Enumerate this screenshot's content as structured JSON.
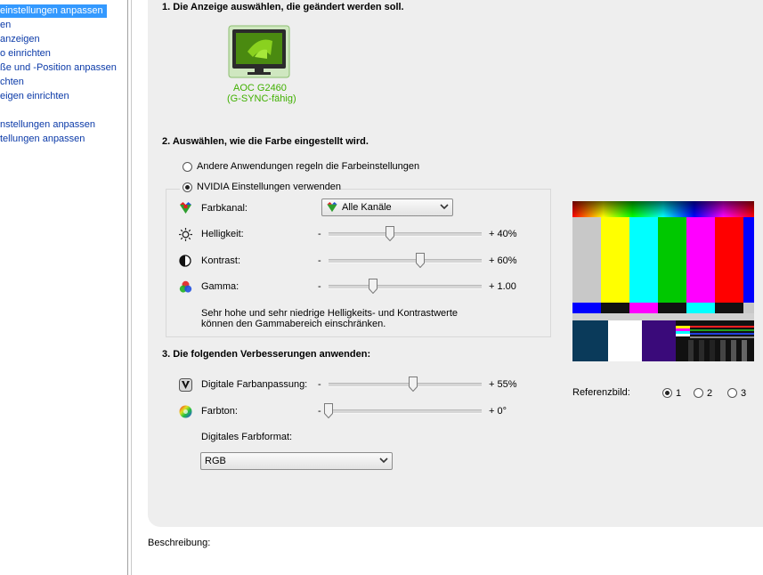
{
  "sidebar": {
    "items": [
      {
        "label": "einstellungen anpassen",
        "selected": true
      },
      {
        "label": "en"
      },
      {
        "label": "anzeigen"
      },
      {
        "label": "o einrichten"
      },
      {
        "label": "ße und -Position anpassen"
      },
      {
        "label": "chten"
      },
      {
        "label": "eigen einrichten"
      },
      {
        "label": "nstellungen anpassen"
      },
      {
        "label": "tellungen anpassen"
      }
    ]
  },
  "section1": {
    "heading": "1. Die Anzeige auswählen, die geändert werden soll.",
    "monitor": {
      "name": "AOC G2460",
      "sub": "(G-SYNC-fähig)",
      "icon": "nvidia-monitor-icon"
    }
  },
  "section2": {
    "heading": "2. Auswählen, wie die Farbe eingestellt wird.",
    "radio_other": "Andere Anwendungen regeln die Farbeinstellungen",
    "radio_nvidia": "NVIDIA Einstellungen verwenden",
    "channel_label": "Farbkanal:",
    "channel_value": "Alle Kanäle",
    "brightness": {
      "label": "Helligkeit:",
      "minus": "-",
      "value": "+ 40%",
      "fraction": 0.4
    },
    "contrast": {
      "label": "Kontrast:",
      "minus": "-",
      "value": "+ 60%",
      "fraction": 0.6
    },
    "gamma": {
      "label": "Gamma:",
      "minus": "-",
      "value": "+ 1.00",
      "fraction": 0.29
    },
    "note_line1": "Sehr hohe und sehr niedrige Helligkeits- und Kontrastwerte",
    "note_line2": "können den Gammabereich einschränken."
  },
  "section3": {
    "heading": "3. Die folgenden Verbesserungen anwenden:",
    "vibrance": {
      "label": "Digitale Farbanpassung:",
      "minus": "-",
      "value": "+ 55%",
      "fraction": 0.55
    },
    "hue": {
      "label": "Farbton:",
      "minus": "-",
      "value": "+ 0°",
      "fraction": 0.0
    },
    "format_label": "Digitales Farbformat:",
    "format_value": "RGB"
  },
  "reference": {
    "label": "Referenzbild:",
    "options": [
      "1",
      "2",
      "3"
    ],
    "selected": "1"
  },
  "description_label": "Beschreibung:"
}
